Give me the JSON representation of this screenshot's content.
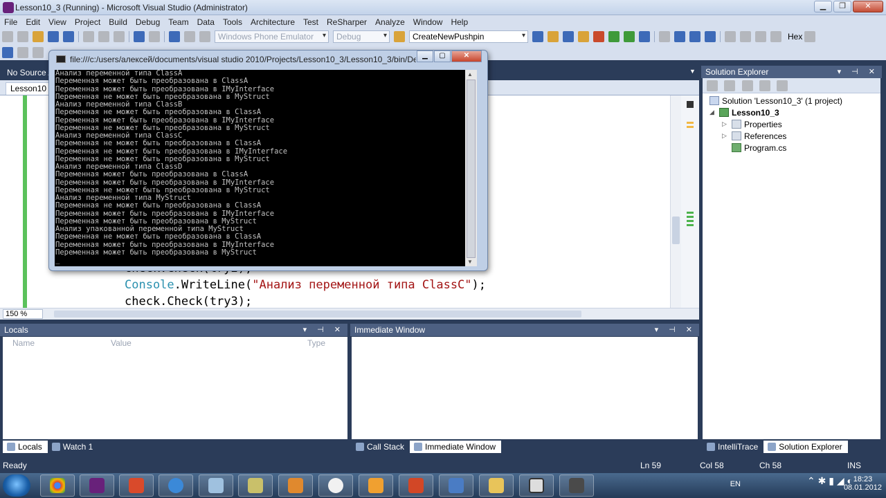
{
  "window": {
    "title": "Lesson10_3 (Running) - Microsoft Visual Studio (Administrator)"
  },
  "menu": [
    "File",
    "Edit",
    "View",
    "Project",
    "Build",
    "Debug",
    "Team",
    "Data",
    "Tools",
    "Architecture",
    "Test",
    "ReSharper",
    "Analyze",
    "Window",
    "Help"
  ],
  "toolbar": {
    "target_combo": "Windows Phone Emulator",
    "config_combo": "Debug",
    "find_combo": "CreateNewPushpin",
    "hex_label": "Hex"
  },
  "editor": {
    "source_strip": "No Source A",
    "tab_label": "Lesson10",
    "code_partial": "check.Check(try2);",
    "code_cls": "Console",
    "code_method": ".WriteLine(",
    "code_string": "\"Анализ переменной типа ClassC\"",
    "code_end": ");",
    "code_line2": "check.Check(try3);",
    "zoom": "150 %"
  },
  "console": {
    "title": "file:///c:/users/алексей/documents/visual studio 2010/Projects/Lesson10_3/Lesson10_3/bin/Debu...",
    "lines": [
      "Анализ переменной типа ClassA",
      "Переменная может быть преобразована в ClassA",
      "Переменная может быть преобразована в IMyInterface",
      "Переменная не может быть преобразована в MyStruct",
      "Анализ переменной типа ClassB",
      "Переменная не может быть преобразована в ClassA",
      "Переменная может быть преобразована в IMyInterface",
      "Переменная не может быть преобразована в MyStruct",
      "Анализ переменной типа ClassC",
      "Переменная не может быть преобразована в ClassA",
      "Переменная не может быть преобразована в IMyInterface",
      "Переменная не может быть преобразована в MyStruct",
      "Анализ переменной типа ClassD",
      "Переменная может быть преобразована в ClassA",
      "Переменная может быть преобразована в IMyInterface",
      "Переменная не может быть преобразована в MyStruct",
      "Анализ переменной типа MyStruct",
      "Переменная не может быть преобразована в ClassA",
      "Переменная может быть преобразована в IMyInterface",
      "Переменная может быть преобразована в MyStruct",
      "Анализ упакованной переменной типа MyStruct",
      "Переменная не может быть преобразована в ClassA",
      "Переменная может быть преобразована в IMyInterface",
      "Переменная может быть преобразована в MyStruct",
      "_"
    ]
  },
  "locals": {
    "title": "Locals",
    "col_name": "Name",
    "col_value": "Value",
    "col_type": "Type"
  },
  "immediate": {
    "title": "Immediate Window"
  },
  "bottom_left_tabs": [
    "Locals",
    "Watch 1"
  ],
  "bottom_mid_tabs": [
    "Call Stack",
    "Immediate Window"
  ],
  "bottom_right_tabs": [
    "IntelliTrace",
    "Solution Explorer"
  ],
  "solution_explorer": {
    "title": "Solution Explorer",
    "solution": "Solution 'Lesson10_3' (1 project)",
    "project": "Lesson10_3",
    "items": [
      "Properties",
      "References",
      "Program.cs"
    ]
  },
  "status": {
    "ready": "Ready",
    "ln": "Ln 59",
    "col": "Col 58",
    "ch": "Ch 58",
    "mode": "INS"
  },
  "taskbar": {
    "lang": "EN",
    "time": "18:23",
    "date": "08.01.2012"
  }
}
